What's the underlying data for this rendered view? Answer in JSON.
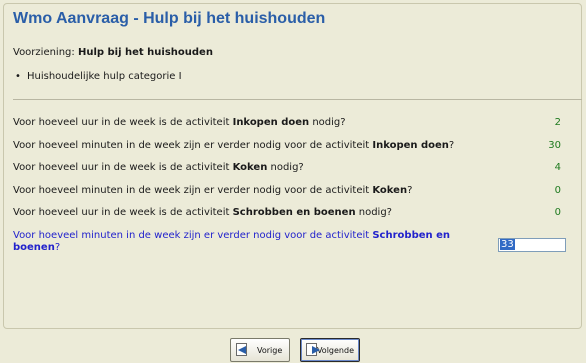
{
  "title": "Wmo Aanvraag - Hulp bij het huishouden",
  "voorziening": {
    "label": "Voorziening: ",
    "value": "Hulp bij het huishouden"
  },
  "category_item": "Huishoudelijke hulp categorie I",
  "questions": [
    {
      "pre": "Voor hoeveel uur in de week is de activiteit ",
      "bold": "Inkopen doen",
      "post": " nodig?",
      "answer": "2"
    },
    {
      "pre": "Voor hoeveel minuten in de week zijn er verder nodig voor de activiteit ",
      "bold": "Inkopen doen",
      "post": "?",
      "answer": "30"
    },
    {
      "pre": "Voor hoeveel uur in de week is de activiteit ",
      "bold": "Koken",
      "post": " nodig?",
      "answer": "4"
    },
    {
      "pre": "Voor hoeveel minuten in de week zijn er verder nodig voor de activiteit ",
      "bold": "Koken",
      "post": "?",
      "answer": "0"
    },
    {
      "pre": "Voor hoeveel uur in de week is de activiteit ",
      "bold": "Schrobben en boenen",
      "post": " nodig?",
      "answer": "0"
    }
  ],
  "active_question": {
    "pre": "Voor hoeveel minuten in de week zijn er verder nodig voor de activiteit ",
    "bold": "Schrobben en boenen",
    "post": "?",
    "input_value": "33"
  },
  "buttons": {
    "prev": "Vorige",
    "next": "Volgende"
  },
  "colors": {
    "title": "#2a5ea8",
    "answer": "#1e7a1e",
    "active_question": "#2222cc",
    "background": "#ecebd8"
  }
}
